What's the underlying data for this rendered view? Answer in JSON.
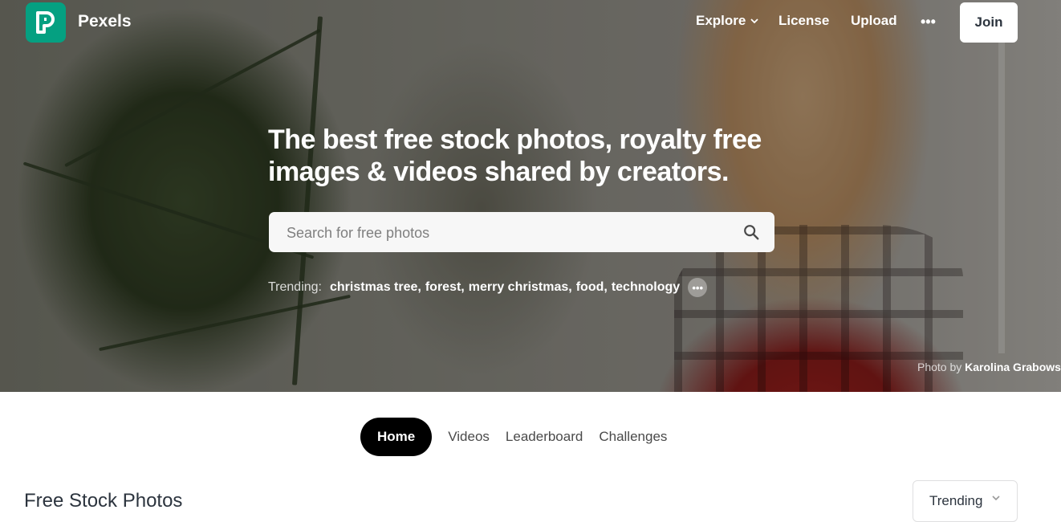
{
  "brand": {
    "name": "Pexels",
    "color": "#05a081"
  },
  "nav": {
    "explore": "Explore",
    "license": "License",
    "upload": "Upload",
    "more": "•••",
    "join": "Join"
  },
  "hero": {
    "headline": "The best free stock photos, royalty free images & videos shared by creators.",
    "search": {
      "placeholder": "Search for free photos",
      "value": ""
    },
    "trending": {
      "label": "Trending:",
      "items": [
        "christmas tree",
        "forest",
        "merry christmas",
        "food",
        "technology"
      ],
      "more": "•••"
    },
    "credit": {
      "prefix": "Photo by",
      "author": "Karolina Grabows"
    }
  },
  "tabs": [
    {
      "label": "Home",
      "active": true
    },
    {
      "label": "Videos",
      "active": false
    },
    {
      "label": "Leaderboard",
      "active": false
    },
    {
      "label": "Challenges",
      "active": false
    }
  ],
  "section": {
    "title": "Free Stock Photos",
    "sort": {
      "selected": "Trending"
    }
  },
  "icons": {
    "logo": "pexels-logo-icon",
    "explore_chevron": "chevron-down-icon",
    "search": "search-icon",
    "sort_chevron": "chevron-down-icon"
  }
}
